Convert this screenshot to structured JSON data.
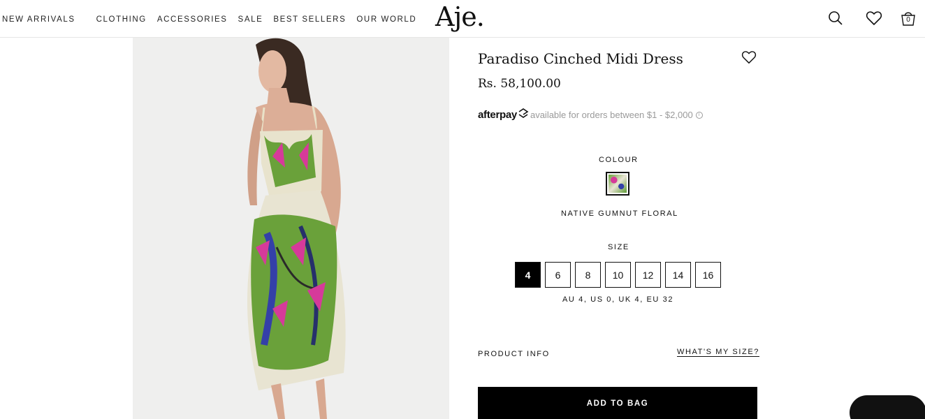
{
  "header": {
    "nav": [
      "NEW ARRIVALS",
      "CLOTHING",
      "ACCESSORIES",
      "SALE",
      "BEST SELLERS",
      "OUR WORLD"
    ],
    "logo": "Aje.",
    "icons": [
      "search-icon",
      "heart-icon",
      "bag-icon"
    ],
    "bag_count": "0"
  },
  "product": {
    "title": "Paradiso Cinched Midi Dress",
    "price": "Rs. 58,100.00",
    "afterpay": {
      "logo": "afterpay",
      "text": "available for orders between $1 - $2,000",
      "info": "i"
    },
    "colour_label": "COLOUR",
    "colour_name": "NATIVE GUMNUT FLORAL",
    "size_label": "SIZE",
    "sizes": [
      "4",
      "6",
      "8",
      "10",
      "12",
      "14",
      "16"
    ],
    "selected_size": "4",
    "size_conversion": "AU 4, US 0, UK 4, EU 32",
    "product_info": "PRODUCT INFO",
    "whats_my_size": "WHAT'S MY SIZE?",
    "add_to_bag": "ADD TO BAG"
  },
  "colors": {
    "accent": "#000000",
    "muted_text": "#9a9a9a",
    "dress_green": "#6aa13a",
    "dress_pink": "#d63a9a",
    "dress_blue": "#3440a8"
  }
}
